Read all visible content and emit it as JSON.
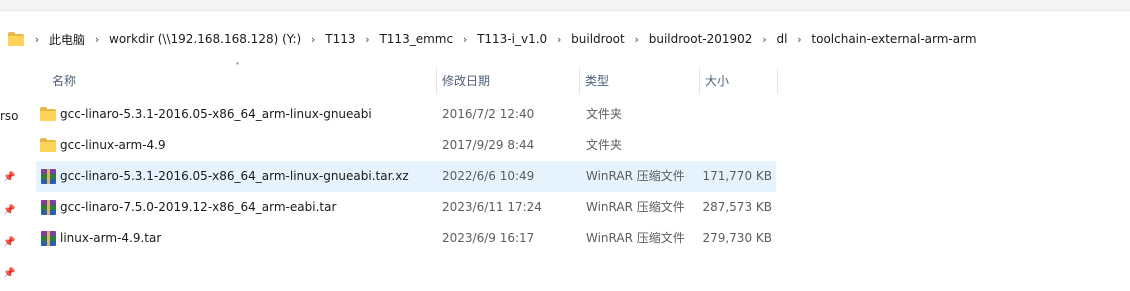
{
  "breadcrumb": {
    "items": [
      "此电脑",
      "workdir (\\\\192.168.168.128) (Y:)",
      "T113",
      "T113_emmc",
      "T113-i_v1.0",
      "buildroot",
      "buildroot-201902",
      "dl",
      "toolchain-external-arm-arm"
    ],
    "separator": "›"
  },
  "sidebar": {
    "fragment_text": "rso"
  },
  "columns": {
    "name": "名称",
    "modified": "修改日期",
    "type": "类型",
    "size": "大小"
  },
  "files": [
    {
      "name": "gcc-linaro-5.3.1-2016.05-x86_64_arm-linux-gnueabi",
      "modified": "2016/7/2 12:40",
      "type": "文件夹",
      "size": "",
      "icon": "folder-icon"
    },
    {
      "name": "gcc-linux-arm-4.9",
      "modified": "2017/9/29 8:44",
      "type": "文件夹",
      "size": "",
      "icon": "folder-icon"
    },
    {
      "name": "gcc-linaro-5.3.1-2016.05-x86_64_arm-linux-gnueabi.tar.xz",
      "modified": "2022/6/6 10:49",
      "type": "WinRAR 压缩文件",
      "size": "171,770 KB",
      "icon": "winrar-archive-icon",
      "selected": true
    },
    {
      "name": "gcc-linaro-7.5.0-2019.12-x86_64_arm-eabi.tar",
      "modified": "2023/6/11 17:24",
      "type": "WinRAR 压缩文件",
      "size": "287,573 KB",
      "icon": "winrar-archive-icon"
    },
    {
      "name": "linux-arm-4.9.tar",
      "modified": "2023/6/9 16:17",
      "type": "WinRAR 压缩文件",
      "size": "279,730 KB",
      "icon": "winrar-archive-icon"
    }
  ],
  "colors": {
    "selected_row": "#e5f3ff",
    "header_text": "#4c607a",
    "folder": "#ffd35a"
  }
}
